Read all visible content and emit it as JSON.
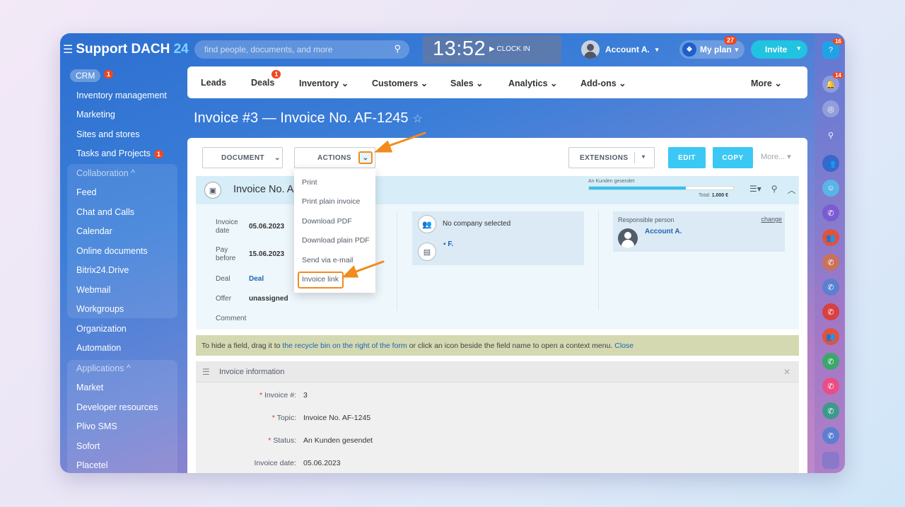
{
  "app": {
    "logo_text": "Support DACH",
    "logo_number": "24",
    "search_placeholder": "find people, documents, and more",
    "clock": "13:52",
    "clock_in": "CLOCK IN",
    "account": "Account A.",
    "my_plan": "My plan",
    "my_plan_badge": "27",
    "invite": "Invite"
  },
  "sidebar": {
    "crm": "CRM",
    "crm_badge": "1",
    "items": [
      {
        "label": "Inventory management"
      },
      {
        "label": "Marketing"
      },
      {
        "label": "Sites and stores"
      },
      {
        "label": "Tasks and Projects",
        "badge": "1"
      },
      {
        "label": "Collaboration ^"
      },
      {
        "label": "Feed"
      },
      {
        "label": "Chat and Calls"
      },
      {
        "label": "Calendar"
      },
      {
        "label": "Online documents"
      },
      {
        "label": "Bitrix24.Drive"
      },
      {
        "label": "Webmail"
      },
      {
        "label": "Workgroups"
      },
      {
        "label": "Organization"
      },
      {
        "label": "Automation"
      },
      {
        "label": "Applications ^"
      },
      {
        "label": "Market"
      },
      {
        "label": "Developer resources"
      },
      {
        "label": "Plivo SMS"
      },
      {
        "label": "Sofort"
      },
      {
        "label": "Placetel"
      }
    ]
  },
  "rightbar": {
    "help_badge": "16",
    "bell_badge": "14"
  },
  "nav": {
    "items": [
      {
        "label": "Leads"
      },
      {
        "label": "Deals",
        "badge": "1"
      },
      {
        "label": "Inventory ⌄"
      },
      {
        "label": "Customers ⌄"
      },
      {
        "label": "Sales ⌄"
      },
      {
        "label": "Analytics ⌄"
      },
      {
        "label": "Add-ons ⌄"
      },
      {
        "label": "More ⌄"
      }
    ]
  },
  "page": {
    "title": "Invoice #3 — Invoice No. AF-1245",
    "star": "☆"
  },
  "toolbar": {
    "document": "DOCUMENT",
    "actions": "ACTIONS",
    "extensions": "EXTENSIONS",
    "edit": "EDIT",
    "copy": "COPY",
    "more": "More... ▾"
  },
  "invoice": {
    "header_title": "Invoice No. AF",
    "status_label": "An Kunden gesendet",
    "status_progress": 0.67,
    "total_label": "Total:",
    "total_value": "1.000 €",
    "fields": {
      "invoice_date_label": "Invoice date",
      "invoice_date": "05.06.2023",
      "pay_before_label": "Pay before",
      "pay_before": "15.06.2023",
      "deal_label": "Deal",
      "deal": "Deal",
      "offer_label": "Offer",
      "offer": "unassigned",
      "comment_label": "Comment"
    },
    "company": "No company selected",
    "contact": "F.",
    "responsible_label": "Responsible person",
    "responsible_change": "change",
    "responsible_name": "Account A."
  },
  "hint": {
    "prefix": "To hide a field, drag it to",
    "link": "the recycle bin on the right of the form",
    "suffix": "or click an icon beside the field name to open a context menu.",
    "close": "Close"
  },
  "info": {
    "title": "Invoice information",
    "rows": [
      {
        "label": "Invoice #:",
        "value": "3",
        "required": true
      },
      {
        "label": "Topic:",
        "value": "Invoice No. AF-1245",
        "required": true
      },
      {
        "label": "Status:",
        "value": "An Kunden gesendet",
        "required": true
      },
      {
        "label": "Invoice date:",
        "value": "05.06.2023",
        "required": false
      }
    ]
  },
  "actions_menu": {
    "items": [
      {
        "label": "Print"
      },
      {
        "label": "Print plain invoice"
      },
      {
        "label": "Download PDF"
      },
      {
        "label": "Download plain PDF"
      },
      {
        "label": "Send via e-mail"
      },
      {
        "label": "Invoice link"
      }
    ]
  },
  "colors": {
    "accent": "#3bc8f5",
    "annotation": "#f28b1e",
    "badge": "#f0471f"
  }
}
